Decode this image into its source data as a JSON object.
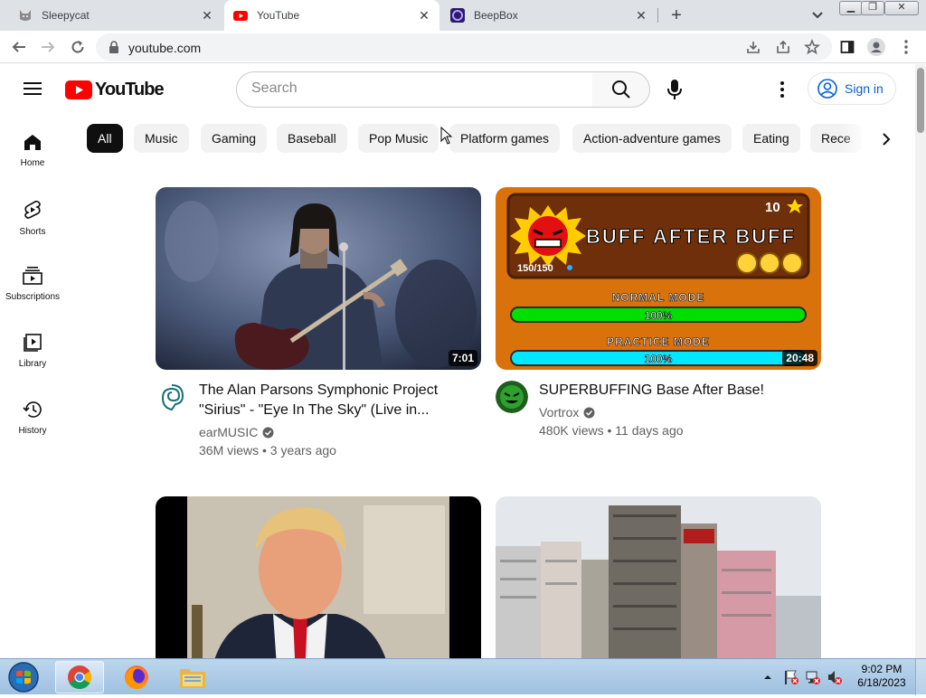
{
  "browser": {
    "tabs": [
      {
        "label": "Sleepycat",
        "icon": "cat-icon"
      },
      {
        "label": "YouTube",
        "icon": "youtube-icon",
        "active": true
      },
      {
        "label": "BeepBox",
        "icon": "beepbox-icon"
      }
    ],
    "url": "youtube.com"
  },
  "youtube": {
    "logo_text": "YouTube",
    "search_placeholder": "Search",
    "signin_label": "Sign in",
    "guide": [
      {
        "label": "Home",
        "icon": "home-icon"
      },
      {
        "label": "Shorts",
        "icon": "shorts-icon"
      },
      {
        "label": "Subscriptions",
        "icon": "subscriptions-icon"
      },
      {
        "label": "Library",
        "icon": "library-icon"
      },
      {
        "label": "History",
        "icon": "history-icon"
      }
    ],
    "chips": [
      "All",
      "Music",
      "Gaming",
      "Baseball",
      "Pop Music",
      "Platform games",
      "Action-adventure games",
      "Eating",
      "Rece"
    ],
    "videos": [
      {
        "title": "The Alan Parsons Symphonic Project \"Sirius\" - \"Eye In The Sky\" (Live in...",
        "channel": "earMUSIC",
        "meta": "36M views • 3 years ago",
        "duration": "7:01"
      },
      {
        "title": "SUPERBUFFING Base After Base!",
        "channel": "Vortrox",
        "meta": "480K views • 11 days ago",
        "duration": "20:48",
        "thumb_text": {
          "stars": "10",
          "headline": "BUFF AFTER BUFF",
          "count": "150/150",
          "normal_mode": "NORMAL MODE",
          "normal_pct": "100%",
          "practice_mode": "PRACTICE MODE",
          "practice_pct": "100%"
        }
      },
      {
        "title": "",
        "channel": "",
        "meta": "",
        "duration": ""
      },
      {
        "title": "",
        "channel": "",
        "meta": "",
        "duration": ""
      }
    ]
  },
  "taskbar": {
    "time": "9:02 PM",
    "date": "6/18/2023",
    "apps": [
      "chrome-icon",
      "firefox-icon",
      "file-explorer-icon"
    ]
  },
  "colors": {
    "youtube_red": "#ff0000",
    "link_blue": "#065fd4",
    "chip_bg": "#f2f2f2",
    "chip_selected_bg": "#0f0f0f"
  }
}
